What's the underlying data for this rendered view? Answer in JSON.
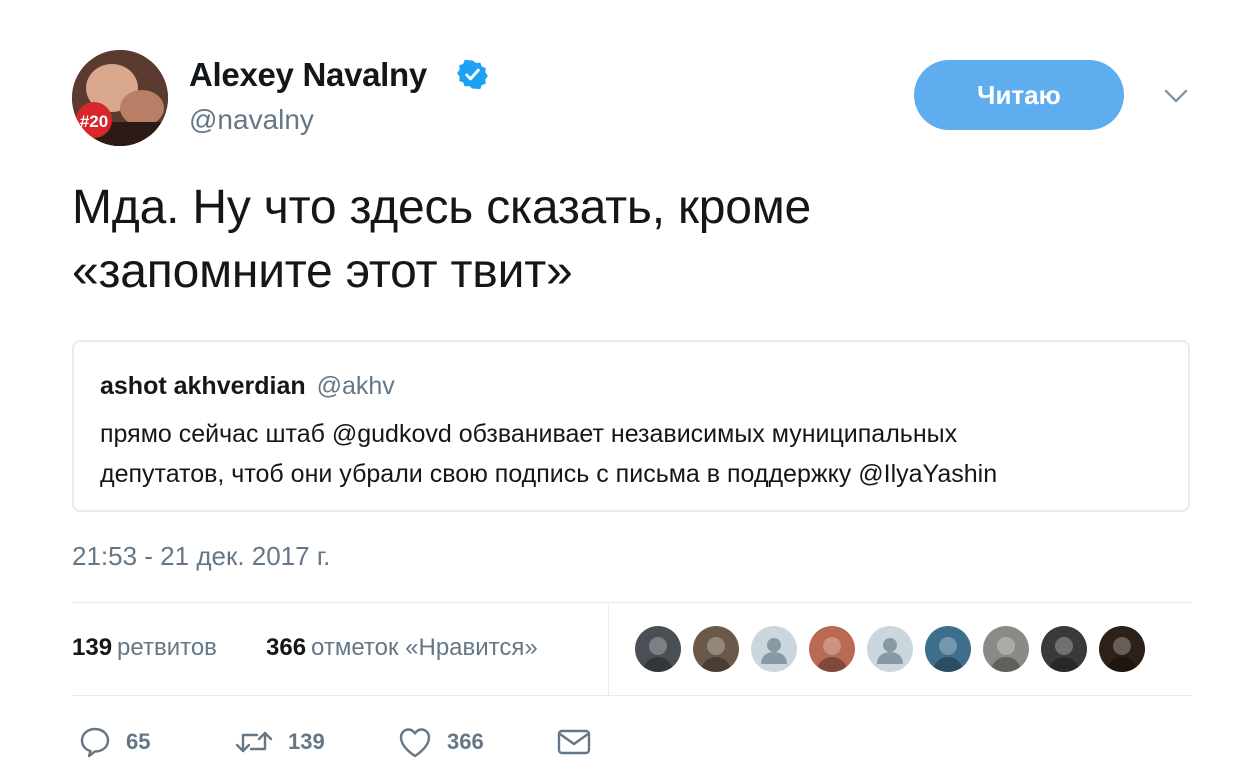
{
  "author": {
    "name": "Alexey Navalny",
    "handle": "@navalny",
    "avatar_badge": "#20",
    "verified": true
  },
  "follow_button_label": "Читаю",
  "tweet": {
    "lines": [
      "Мда. Ну что здесь сказать, кроме",
      "«запомните этот твит»"
    ]
  },
  "quoted_tweet": {
    "author_name": "ashot akhverdian",
    "author_handle": "@akhv",
    "lines": [
      "прямо сейчас штаб @gudkovd обзванивает независимых муниципальных",
      "депутатов, чтоб они убрали свою подпись с письма в поддержку @IlyaYashin"
    ]
  },
  "timestamp": "21:53 - 21 дек. 2017 г.",
  "stats": {
    "retweets_count": "139",
    "retweets_label": "ретвитов",
    "likes_count": "366",
    "likes_label": "отметок «Нравится»"
  },
  "likers": [
    {
      "icon": "photo-avatar",
      "color": "#4a4f55"
    },
    {
      "icon": "photo-avatar",
      "color": "#6b5a4a"
    },
    {
      "icon": "default-avatar",
      "color": "#ccd6dd"
    },
    {
      "icon": "photo-avatar",
      "color": "#b86a52"
    },
    {
      "icon": "default-avatar",
      "color": "#ccd6dd"
    },
    {
      "icon": "photo-avatar",
      "color": "#3d6f8c"
    },
    {
      "icon": "photo-avatar",
      "color": "#8a8a86"
    },
    {
      "icon": "photo-avatar",
      "color": "#3a3a3a"
    },
    {
      "icon": "photo-avatar",
      "color": "#2c2018"
    }
  ],
  "actions": {
    "reply_count": "65",
    "retweet_count": "139",
    "like_count": "366"
  },
  "colors": {
    "accent": "#5eaeef",
    "verified": "#1da1f2",
    "secondary_text": "#657786",
    "border": "#e6ecf0"
  }
}
